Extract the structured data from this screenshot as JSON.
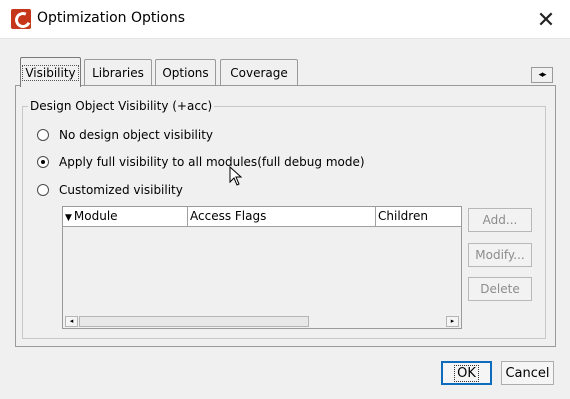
{
  "window": {
    "title": "Optimization Options",
    "close_label": "✕"
  },
  "tabs": [
    {
      "label": "Visibility",
      "active": true
    },
    {
      "label": "Libraries",
      "active": false
    },
    {
      "label": "Options",
      "active": false
    },
    {
      "label": "Coverage",
      "active": false
    }
  ],
  "tab_scroll_label": "◂▸",
  "group": {
    "title": "Design Object Visibility (+acc)",
    "options": [
      {
        "label": "No design object visibility",
        "checked": false
      },
      {
        "label": "Apply full visibility to all modules(full debug mode)",
        "checked": true
      },
      {
        "label": "Customized visibility",
        "checked": false
      }
    ]
  },
  "table": {
    "sort_glyph": "▼",
    "columns": [
      "Module",
      "Access Flags",
      "Children"
    ],
    "rows": [],
    "scroll_left": "◂",
    "scroll_right": "▸"
  },
  "side_buttons": {
    "add": "Add...",
    "modify": "Modify...",
    "delete": "Delete"
  },
  "buttons": {
    "ok": "OK",
    "cancel": "Cancel"
  },
  "colors": {
    "accent": "#0f6cbd",
    "app_icon": "#c6361a",
    "disabled_text": "#8c8c8c"
  }
}
